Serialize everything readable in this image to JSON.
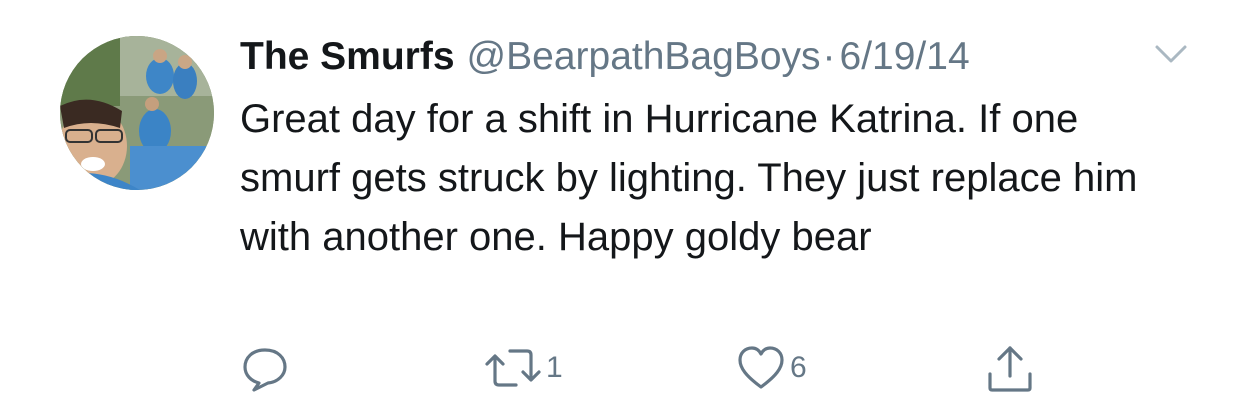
{
  "tweet": {
    "display_name": "The Smurfs",
    "handle": "@BearpathBagBoys",
    "separator": "·",
    "date": "6/19/14",
    "text": "Great day for a shift in Hurricane Katrina. If one smurf gets struck by lighting. They just replace him with another one. Happy goldy bear",
    "avatar_icon": "profile-photo",
    "menu_icon": "chevron-down-icon"
  },
  "actions": {
    "reply": {
      "icon": "reply-icon",
      "count": ""
    },
    "retweet": {
      "icon": "retweet-icon",
      "count": "1"
    },
    "like": {
      "icon": "heart-icon",
      "count": "6"
    },
    "share": {
      "icon": "share-icon",
      "count": ""
    }
  },
  "colors": {
    "text": "#14171a",
    "secondary": "#657786",
    "background": "#ffffff"
  }
}
